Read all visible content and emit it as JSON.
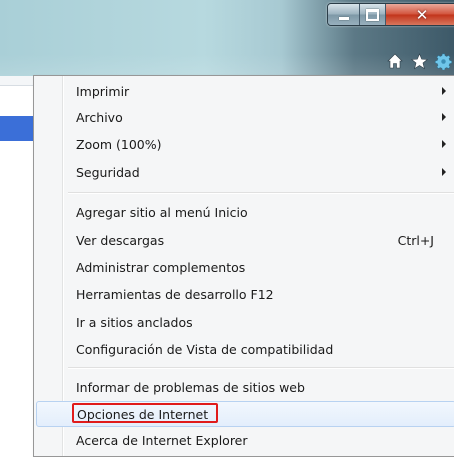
{
  "window": {
    "caption_buttons": [
      "minimize",
      "maximize",
      "close"
    ]
  },
  "toolbar": {
    "icons": [
      "home-icon",
      "favorites-star-icon",
      "tools-gear-icon"
    ],
    "colors": {
      "home": "#ffffff",
      "star": "#ffffff",
      "gear": "#6fc6ea"
    }
  },
  "menu": {
    "group1": [
      {
        "label": "Imprimir",
        "submenu": true
      },
      {
        "label": "Archivo",
        "submenu": true
      },
      {
        "label": "Zoom (100%)",
        "submenu": true
      },
      {
        "label": "Seguridad",
        "submenu": true
      }
    ],
    "group2": [
      {
        "label": "Agregar sitio al menú Inicio"
      },
      {
        "label": "Ver descargas",
        "shortcut": "Ctrl+J"
      },
      {
        "label": "Administrar complementos"
      },
      {
        "label": "Herramientas de desarrollo F12"
      },
      {
        "label": "Ir a sitios anclados"
      },
      {
        "label": "Configuración de Vista de compatibilidad"
      }
    ],
    "group3": [
      {
        "label": "Informar de problemas de sitios web"
      },
      {
        "label": "Opciones de Internet",
        "highlighted": true
      },
      {
        "label": "Acerca de Internet Explorer"
      }
    ],
    "highlight_color": "#e01b1b"
  }
}
